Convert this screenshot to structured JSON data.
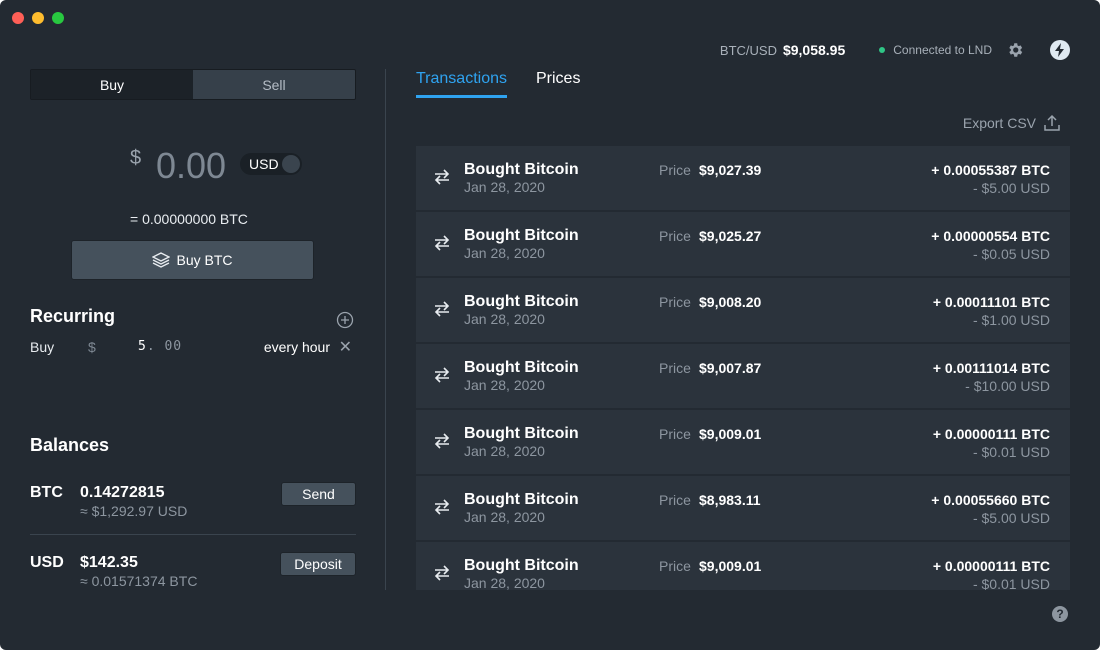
{
  "header": {
    "pair_label": "BTC/USD",
    "pair_value": "$9,058.95",
    "status_text": "Connected to LND",
    "status_color": "#2fc586"
  },
  "trade": {
    "tabs": [
      "Buy",
      "Sell"
    ],
    "active_tab": "Buy",
    "currency_symbol": "$",
    "amount": "0.00",
    "currency": "USD",
    "btc_equivalent": "= 0.00000000 BTC",
    "buy_button": "Buy BTC",
    "buy_button_icon": "layers-icon"
  },
  "recurring": {
    "title": "Recurring",
    "action": "Buy",
    "currency_symbol": "$",
    "amount_whole": "5",
    "amount_cents": ". 00",
    "frequency": "every hour"
  },
  "balances": {
    "title": "Balances",
    "items": [
      {
        "currency": "BTC",
        "amount": "0.14272815",
        "converted": "≈ $1,292.97 USD",
        "action": "Send"
      },
      {
        "currency": "USD",
        "amount": "$142.35",
        "converted": "≈ 0.01571374 BTC",
        "action": "Deposit"
      }
    ]
  },
  "main": {
    "tabs": [
      "Transactions",
      "Prices"
    ],
    "active_tab": "Transactions",
    "active_color": "#2fa3f0",
    "export_label": "Export CSV",
    "price_label": "Price",
    "transactions": [
      {
        "title": "Bought Bitcoin",
        "date": "Jan 28, 2020",
        "price": "$9,027.39",
        "btc": "+ 0.00055387 BTC",
        "usd": "- $5.00 USD"
      },
      {
        "title": "Bought Bitcoin",
        "date": "Jan 28, 2020",
        "price": "$9,025.27",
        "btc": "+ 0.00000554 BTC",
        "usd": "- $0.05 USD"
      },
      {
        "title": "Bought Bitcoin",
        "date": "Jan 28, 2020",
        "price": "$9,008.20",
        "btc": "+ 0.00011101 BTC",
        "usd": "- $1.00 USD"
      },
      {
        "title": "Bought Bitcoin",
        "date": "Jan 28, 2020",
        "price": "$9,007.87",
        "btc": "+ 0.00111014 BTC",
        "usd": "- $10.00 USD"
      },
      {
        "title": "Bought Bitcoin",
        "date": "Jan 28, 2020",
        "price": "$9,009.01",
        "btc": "+ 0.00000111 BTC",
        "usd": "- $0.01 USD"
      },
      {
        "title": "Bought Bitcoin",
        "date": "Jan 28, 2020",
        "price": "$8,983.11",
        "btc": "+ 0.00055660 BTC",
        "usd": "- $5.00 USD"
      },
      {
        "title": "Bought Bitcoin",
        "date": "Jan 28, 2020",
        "price": "$9,009.01",
        "btc": "+ 0.00000111 BTC",
        "usd": "- $0.01 USD"
      }
    ]
  },
  "help_label": "?"
}
